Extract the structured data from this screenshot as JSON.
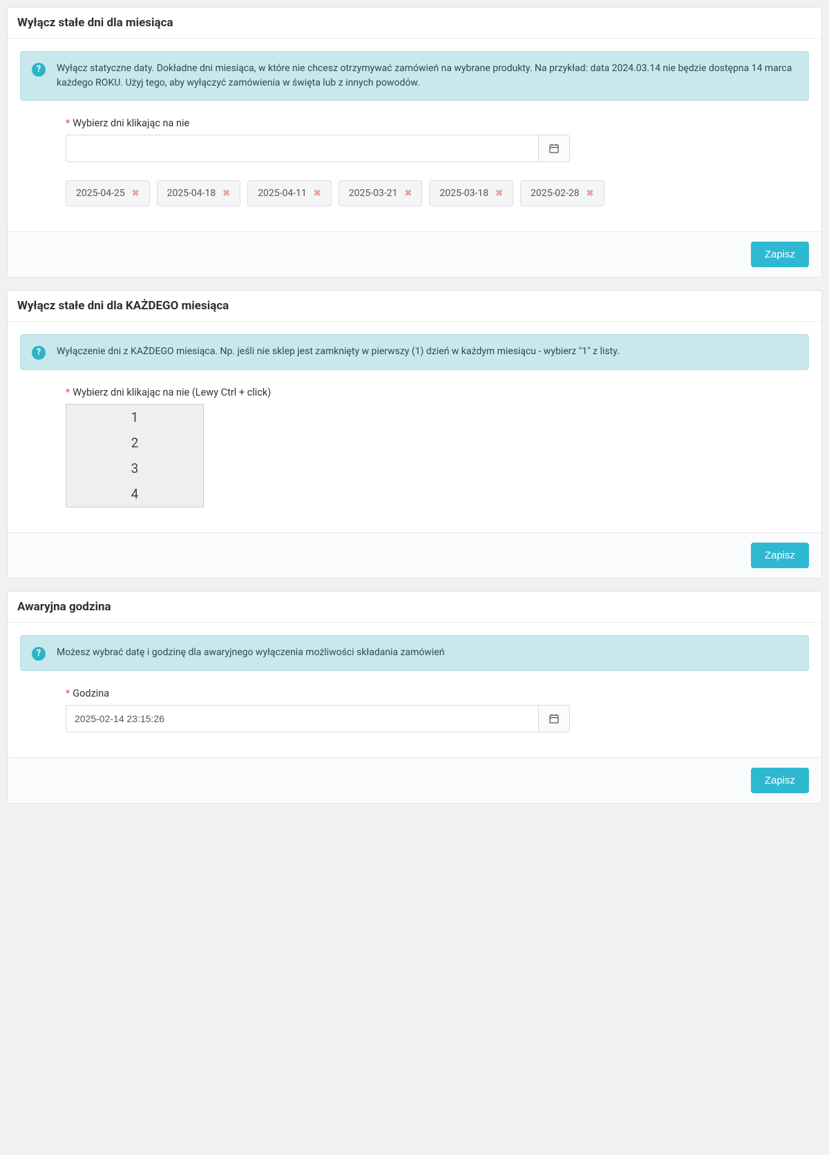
{
  "section1": {
    "title": "Wyłącz stałe dni dla miesiąca",
    "info": "Wyłącz statyczne daty. Dokładne dni miesiąca, w które nie chcesz otrzymywać zamówień na wybrane produkty. Na przykład: data 2024.03.14 nie będzie dostępna 14 marca każdego ROKU. Użyj tego, aby wyłączyć zamówienia w święta lub z innych powodów.",
    "label": "Wybierz dni klikając na nie",
    "dates": [
      "2025-04-25",
      "2025-04-18",
      "2025-04-11",
      "2025-03-21",
      "2025-03-18",
      "2025-02-28"
    ],
    "save": "Zapisz"
  },
  "section2": {
    "title": "Wyłącz stałe dni dla KAŻDEGO miesiąca",
    "info": "Wyłączenie dni z KAŻDEGO miesiąca. Np. jeśli nie sklep jest zamknięty w pierwszy (1) dzień w każdym miesiącu - wybierz \"1\" z listy.",
    "label": "Wybierz dni klikając na nie (Lewy Ctrl + click)",
    "options": [
      "1",
      "2",
      "3",
      "4"
    ],
    "save": "Zapisz"
  },
  "section3": {
    "title": "Awaryjna godzina",
    "info": "Możesz wybrać datę i godzinę dla awaryjnego wyłączenia możliwości składania zamówień",
    "label": "Godzina",
    "value": "2025-02-14 23:15:26",
    "save": "Zapisz"
  }
}
